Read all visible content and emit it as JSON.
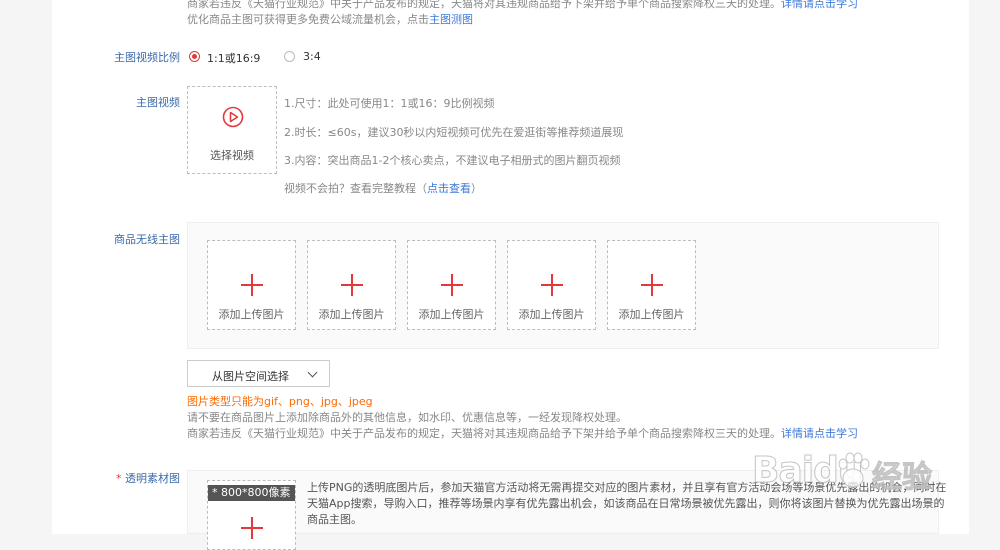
{
  "top_notice": {
    "line1": "商家若违反《天猫行业规范》中关于产品发布的规定，天猫将对其违规商品给予下架并给予单个商品搜索降权三天的处理。",
    "line1_link": "详情请点击学习",
    "line2": "优化商品主图可获得更多免费公域流量机会，点击",
    "line2_link": "主图测图"
  },
  "video_ratio": {
    "label": "主图视频比例",
    "options": [
      "1:1或16:9",
      "3:4"
    ],
    "selected": "1:1或16:9"
  },
  "main_video": {
    "label": "主图视频",
    "select_label": "选择视频",
    "tips": [
      "1.尺寸：此处可使用1：1或16：9比例视频",
      "2.时长：≤60s，建议30秒以内短视频可优先在爱逛街等推荐频道展现",
      "3.内容：突出商品1-2个核心卖点，不建议电子相册式的图片翻页视频"
    ],
    "help_prefix": "视频不会拍？查看完整教程（",
    "help_link": "点击查看",
    "help_suffix": "）"
  },
  "wireless_images": {
    "label": "商品无线主图",
    "slots": [
      "添加上传图片",
      "添加上传图片",
      "添加上传图片",
      "添加上传图片",
      "添加上传图片"
    ],
    "space_button": "从图片空间选择",
    "type_hint": "图片类型只能为gif、png、jpg、jpeg",
    "note1": "请不要在商品图片上添加除商品外的其他信息，如水印、优惠信息等，一经发现降权处理。",
    "note2": "商家若违反《天猫行业规范》中关于产品发布的规定，天猫将对其违规商品给予下架并给予单个商品搜索降权三天的处理。",
    "note2_link": "详情请点击学习"
  },
  "transparent_material": {
    "required_mark": "*",
    "label": "透明素材图",
    "badge": "* 800*800像素",
    "desc_line1": "上传PNG的透明底图片后，参加天猫官方活动将无需再提交对应的图片素材，并且享有官方活动会场等场景优先露出的机会，同时在",
    "desc_line2": "天猫App搜索，导购入口，推荐等场景内享有优先露出机会，如该商品在日常场景被优先露出，则你将该图片替换为优先露出场景的",
    "desc_line3": "商品主图。"
  },
  "watermark": {
    "brand": "Baidu",
    "suffix": "经验"
  },
  "colors": {
    "accent_red": "#e4393c",
    "link_blue": "#3c78d8",
    "label_blue": "#3c6aa8",
    "warn_orange": "#ff6a00"
  }
}
